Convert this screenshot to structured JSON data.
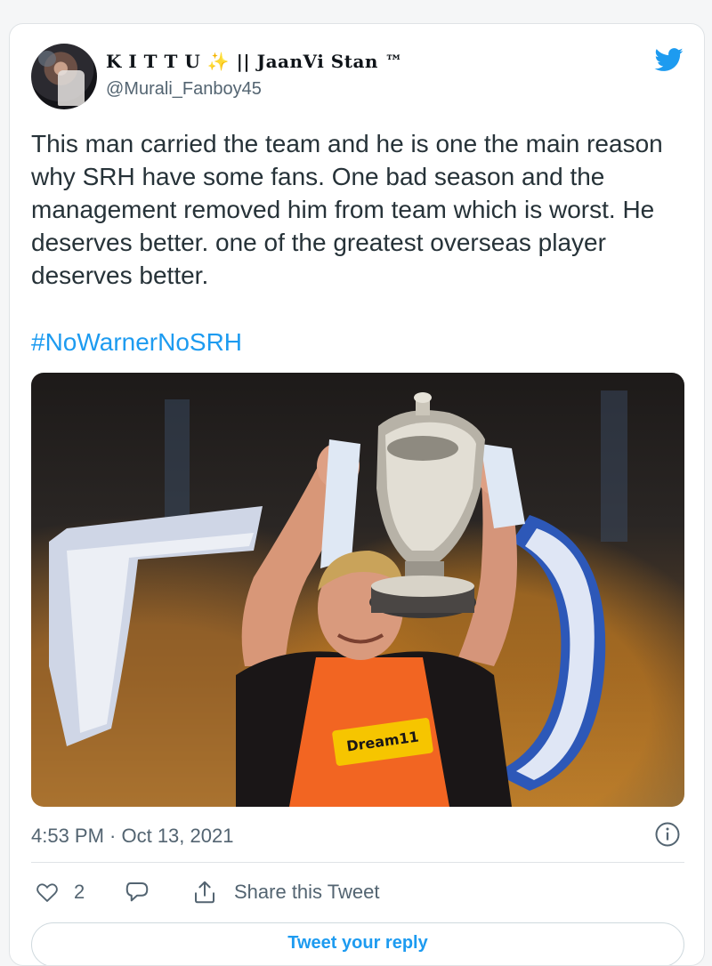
{
  "tweet": {
    "display_name": "K I T T U ✨ || JaanVi Stan ™",
    "handle": "@Murali_Fanboy45",
    "text": "This man carried the team and he is one the main reason why SRH have some fans. One bad season and the management removed him from team which is worst. He deserves better. one of the greatest overseas player deserves better.",
    "hashtag": "#NoWarnerNoSRH",
    "timestamp": "4:53 PM · Oct 13, 2021",
    "like_count": "2",
    "share_label": "Share this Tweet",
    "reply_label": "Tweet your reply"
  },
  "photo": {
    "jersey_text": "Dream11"
  },
  "colors": {
    "accent": "#1d9bf0",
    "muted_text": "#536471",
    "jersey": "#f26522"
  },
  "icons": [
    "twitter-bird-icon",
    "info-icon",
    "heart-icon",
    "reply-icon",
    "share-icon"
  ]
}
